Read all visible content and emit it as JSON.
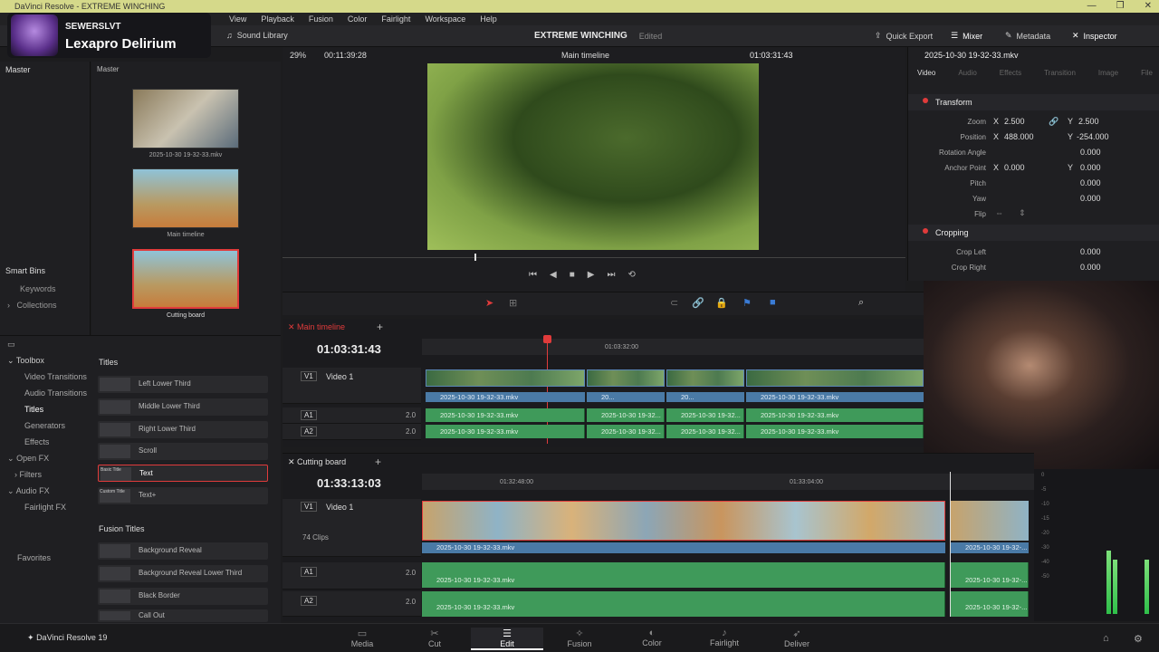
{
  "window": {
    "title": "DaVinci Resolve - EXTREME WINCHING",
    "controls": [
      "—",
      "❐",
      "✕"
    ]
  },
  "menu": [
    "View",
    "Playback",
    "Fusion",
    "Color",
    "Fairlight",
    "Workspace",
    "Help"
  ],
  "overlay": {
    "channel": "SEWERSLVT",
    "game": "Lexapro Delirium"
  },
  "toolbar": {
    "sound_library": "Sound Library",
    "project_title": "EXTREME WINCHING",
    "project_status": "Edited",
    "quick_export": "Quick Export",
    "mixer": "Mixer",
    "metadata": "Metadata",
    "inspector": "Inspector"
  },
  "viewer": {
    "zoom": "29%",
    "duration": "00:11:39:28",
    "timeline_name": "Main timeline",
    "timecode": "01:03:31:43",
    "clip_name": "2025-10-30 19-32-33.mkv"
  },
  "media_pool": {
    "left_header": "Master",
    "right_header": "Master",
    "items": [
      {
        "label": "2025-10-30 19-32-33.mkv"
      },
      {
        "label": "Main timeline"
      },
      {
        "label": "Cutting board"
      }
    ],
    "smart_bins": "Smart Bins",
    "keywords": "Keywords",
    "collections": "Collections"
  },
  "effects": {
    "toolbox": "Toolbox",
    "categories": [
      "Video Transitions",
      "Audio Transitions",
      "Titles",
      "Generators",
      "Effects",
      "Open FX",
      "Filters",
      "Audio FX",
      "Fairlight FX"
    ],
    "favorites": "Favorites",
    "titles_header": "Titles",
    "titles": [
      {
        "thumb": "",
        "label": "Left Lower Third"
      },
      {
        "thumb": "",
        "label": "Middle Lower Third"
      },
      {
        "thumb": "",
        "label": "Right Lower Third"
      },
      {
        "thumb": "",
        "label": "Scroll"
      },
      {
        "thumb": "Basic Title",
        "label": "Text"
      },
      {
        "thumb": "Custom Title",
        "label": "Text+"
      }
    ],
    "fusion_header": "Fusion Titles",
    "fusion": [
      "Background Reveal",
      "Background Reveal Lower Third",
      "Black Border",
      "Call Out"
    ]
  },
  "timeline1": {
    "tab": "Main timeline",
    "timecode": "01:03:31:43",
    "ruler_mark": "01:03:32:00",
    "v1": "V1",
    "v1_name": "Video 1",
    "a1": "A1",
    "a2": "A2",
    "level": "2.0",
    "clips_v": [
      "2025-10-30 19-32-33.mkv",
      "20...",
      "20...",
      "2025-10-30 19-32-33.mkv"
    ],
    "clips_a": [
      "2025-10-30 19-32-33.mkv",
      "2025-10-30 19-32...",
      "2025-10-30 19-32...",
      "2025-10-30 19-32-33.mkv"
    ]
  },
  "timeline2": {
    "tab": "Cutting board",
    "timecode": "01:33:13:03",
    "ruler_marks": [
      "01:32:48:00",
      "01:33:04:00"
    ],
    "v1": "V1",
    "v1_name": "Video 1",
    "clips_count": "74 Clips",
    "a1": "A1",
    "a2": "A2",
    "level": "2.0",
    "clip": "2025-10-30 19-32-33.mkv",
    "clip_short": "2025-10-30 19-32-..."
  },
  "inspector": {
    "tabs": [
      "Video",
      "Audio",
      "Effects",
      "Transition",
      "Image",
      "File"
    ],
    "transform": "Transform",
    "zoom_label": "Zoom",
    "zoom_x": "2.500",
    "zoom_y": "2.500",
    "position_label": "Position",
    "pos_x": "488.000",
    "pos_y": "-254.000",
    "rotation_label": "Rotation Angle",
    "rotation": "0.000",
    "anchor_label": "Anchor Point",
    "anchor_x": "0.000",
    "anchor_y": "0.000",
    "pitch_label": "Pitch",
    "pitch": "0.000",
    "yaw_label": "Yaw",
    "yaw": "0.000",
    "flip_label": "Flip",
    "cropping": "Cropping",
    "crop_left_label": "Crop Left",
    "crop_left": "0.000",
    "crop_right_label": "Crop Right",
    "crop_right": "0.000",
    "x": "X",
    "y": "Y"
  },
  "pages": {
    "app_name": "DaVinci Resolve 19",
    "tabs": [
      "Media",
      "Cut",
      "Edit",
      "Fusion",
      "Color",
      "Fairlight",
      "Deliver"
    ],
    "active": "Edit"
  },
  "meters": [
    "0",
    "-5",
    "-10",
    "-15",
    "-20",
    "-30",
    "-40",
    "-50"
  ],
  "colors": {
    "accent_red": "#e03b3b",
    "clip_blue": "#4a7aa6",
    "audio_green": "#3f9a5a",
    "titlebar": "#d5d98a"
  }
}
